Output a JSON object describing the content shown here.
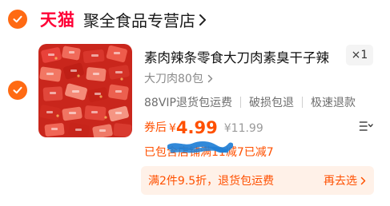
{
  "shop": {
    "logo_text": "天猫",
    "name": "聚全食品专营店",
    "icons": {
      "select": "check-circle-icon",
      "open": "chevron-right-icon"
    }
  },
  "item": {
    "title": "素肉辣条零食大刀肉素臭干子辣",
    "quantity": "×1",
    "sku": "大刀肉80包",
    "services": [
      "88VIP退货包运费",
      "破损包退",
      "极速退款"
    ],
    "price": {
      "label": "券后",
      "currency": "¥",
      "value": "4.99",
      "original": "¥11.99"
    },
    "promo_progress": "已包含店铺满11减7已减7",
    "image": {
      "description": "product-photo"
    }
  },
  "promo": {
    "text": "满2件9.5折，退货包运费",
    "action": "再去选"
  },
  "colors": {
    "accent": "#ff5000",
    "check": "#ff6a13",
    "tmall": "#ff0036",
    "banner_bg": "#fff1e8",
    "scribble": "#1f7fd6"
  }
}
